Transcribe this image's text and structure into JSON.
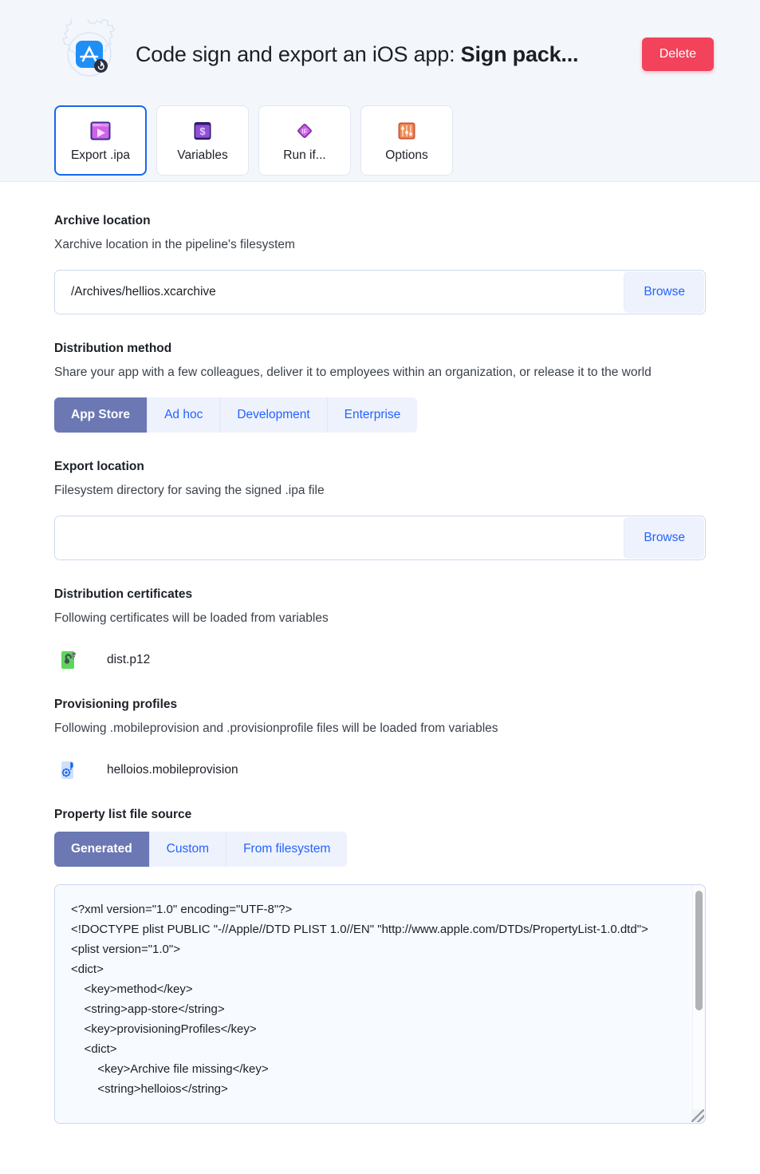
{
  "header": {
    "app_icon": "app-store-export-icon",
    "title_regular": "Code sign and export an iOS app: ",
    "title_bold": "Sign pack...",
    "delete_label": "Delete",
    "delete_color": "#f2425c",
    "tabs": [
      {
        "label": "Export .ipa",
        "icon": "export-ipa-icon",
        "selected": true
      },
      {
        "label": "Variables",
        "icon": "variables-dollar-icon",
        "selected": false
      },
      {
        "label": "Run if...",
        "icon": "run-if-diamond-icon",
        "selected": false
      },
      {
        "label": "Options",
        "icon": "options-sliders-icon",
        "selected": false
      }
    ]
  },
  "archive_location": {
    "title": "Archive location",
    "description": "Xarchive location in the pipeline's filesystem",
    "value": "/Archives/hellios.xcarchive",
    "placeholder": "",
    "browse_label": "Browse"
  },
  "distribution_method": {
    "title": "Distribution method",
    "description": "Share your app with a few colleagues, deliver it to employees within an organization, or release it to the world",
    "options": [
      "App Store",
      "Ad hoc",
      "Development",
      "Enterprise"
    ],
    "selected": "App Store"
  },
  "export_location": {
    "title": "Export location",
    "description": "Filesystem directory for saving the signed .ipa file",
    "value": "",
    "placeholder": "",
    "browse_label": "Browse"
  },
  "distribution_certificates": {
    "title": "Distribution certificates",
    "description": "Following certificates will be loaded from variables",
    "files": [
      {
        "name": "dist.p12",
        "icon": "certificate-p12-icon"
      }
    ]
  },
  "provisioning_profiles": {
    "title": "Provisioning profiles",
    "description": "Following .mobileprovision and .provisionprofile files will be loaded from variables",
    "files": [
      {
        "name": "helloios.mobileprovision",
        "icon": "mobileprovision-icon"
      }
    ]
  },
  "property_list": {
    "title": "Property list file source",
    "options": [
      "Generated",
      "Custom",
      "From filesystem"
    ],
    "selected": "Generated",
    "content": "<?xml version=\"1.0\" encoding=\"UTF-8\"?>\n<!DOCTYPE plist PUBLIC \"-//Apple//DTD PLIST 1.0//EN\" \"http://www.apple.com/DTDs/PropertyList-1.0.dtd\">\n<plist version=\"1.0\">\n<dict>\n    <key>method</key>\n    <string>app-store</string>\n    <key>provisioningProfiles</key>\n    <dict>\n        <key>Archive file missing</key>\n        <string>helloios</string>"
  },
  "colors": {
    "accent_blue": "#2563ff",
    "segment_selected": "#6b78b4",
    "delete_red": "#f2425c",
    "header_bg": "#f3f7fc"
  }
}
